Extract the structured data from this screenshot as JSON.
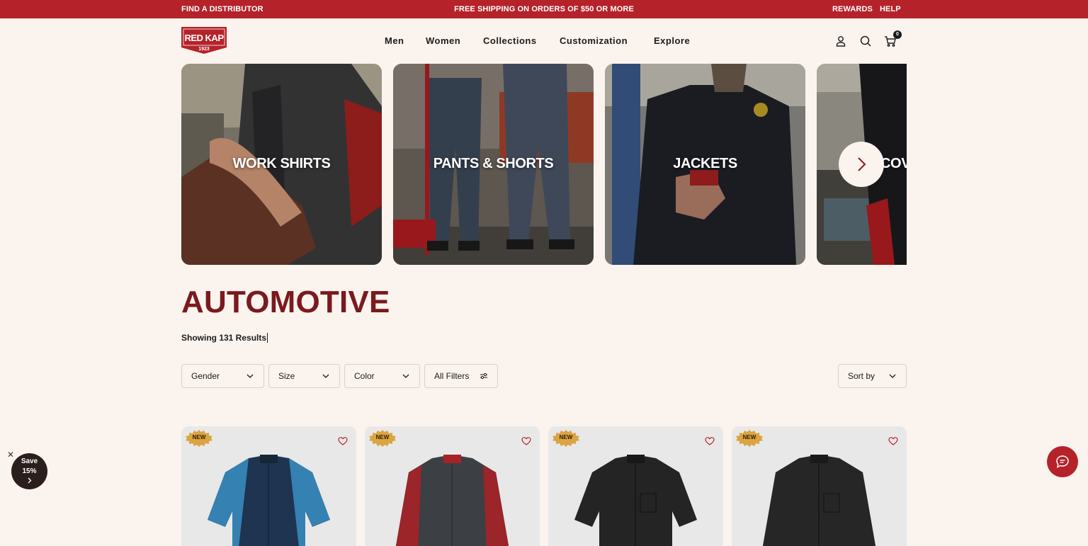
{
  "announcement": {
    "left_link": "FIND A DISTRIBUTOR",
    "center_text": "FREE SHIPPING ON ORDERS OF $50 OR MORE",
    "rewards_link": "REWARDS",
    "help_link": "HELP"
  },
  "brand": {
    "logo_text": "RED KAP",
    "logo_year": "1923"
  },
  "nav": {
    "items": [
      "Men",
      "Women",
      "Collections",
      "Customization",
      "Explore"
    ]
  },
  "header": {
    "cart_count": "0"
  },
  "categories": [
    {
      "label": "WORK SHIRTS"
    },
    {
      "label": "PANTS & SHORTS"
    },
    {
      "label": "JACKETS"
    },
    {
      "label": "COVERALLS"
    }
  ],
  "page": {
    "title": "AUTOMOTIVE",
    "results_text": "Showing 131 Results"
  },
  "filters": {
    "gender": "Gender",
    "size": "Size",
    "color": "Color",
    "all_filters": "All Filters",
    "sort_by": "Sort by"
  },
  "products": [
    {
      "badge": "NEW",
      "shirt_color": "#1e3450",
      "accent_color": "#3a8fc2"
    },
    {
      "badge": "NEW",
      "shirt_color": "#3c3f44",
      "accent_color": "#a52226"
    },
    {
      "badge": "NEW",
      "shirt_color": "#242424",
      "accent_color": "#242424"
    },
    {
      "badge": "NEW",
      "shirt_color": "#262626",
      "accent_color": "#262626"
    }
  ],
  "promo": {
    "line1": "Save",
    "line2": "15%"
  },
  "colors": {
    "brand_red": "#b5222a",
    "title_red": "#7a1a1e",
    "background": "#fbf3ee",
    "badge_gold": "#d9a441"
  }
}
